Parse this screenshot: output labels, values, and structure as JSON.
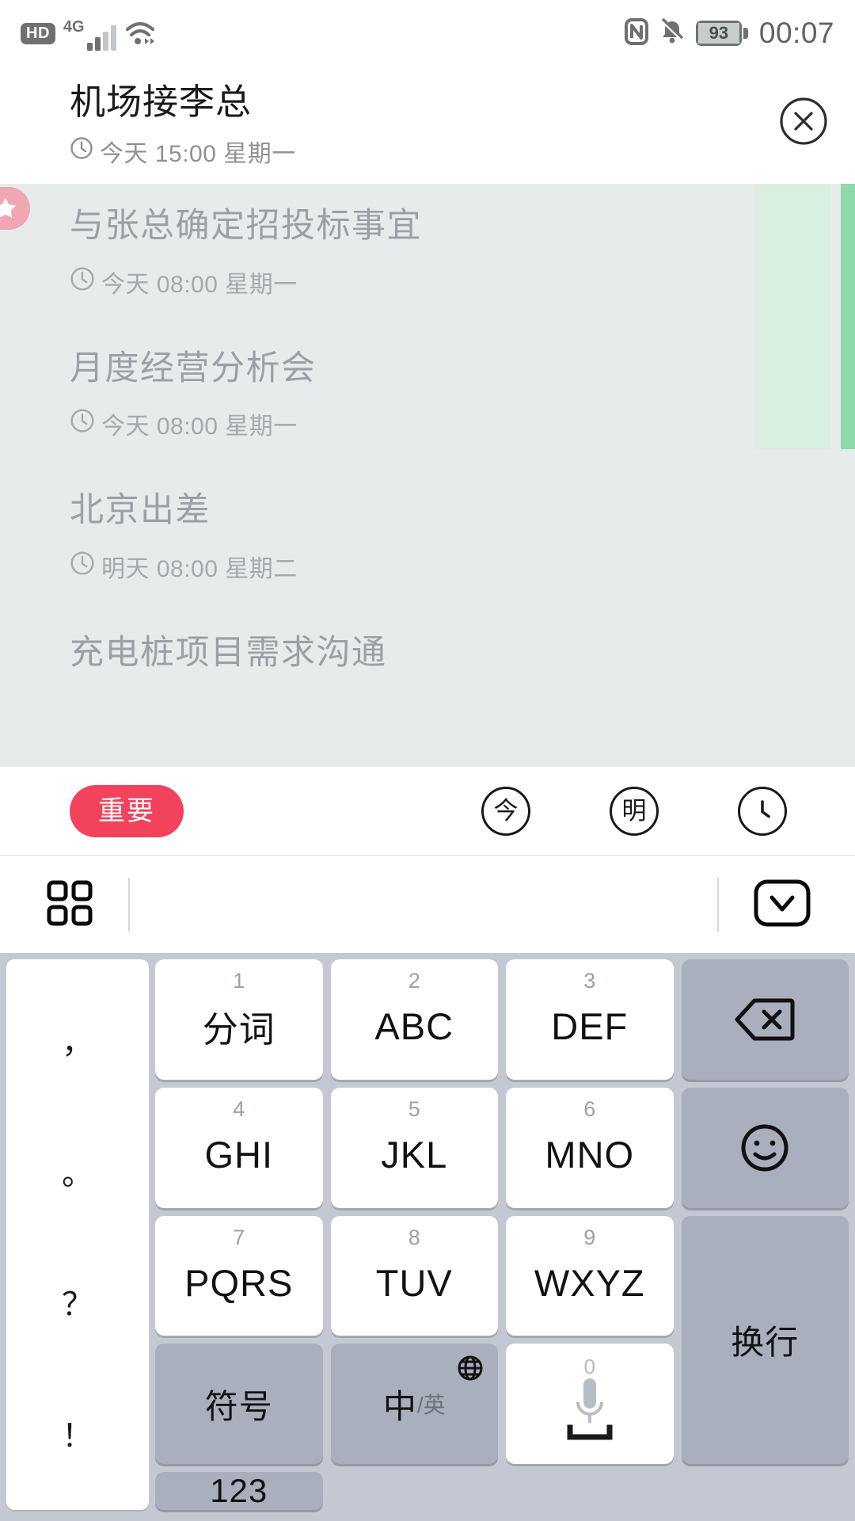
{
  "statusbar": {
    "hd_label": "HD",
    "network_label": "4G",
    "battery_level": "93",
    "time": "00:07",
    "icons": [
      "hd-badge",
      "signal-bars-icon",
      "wifi-icon",
      "nfc-icon",
      "bell-muted-icon",
      "battery-icon"
    ]
  },
  "header": {
    "title": "机场接李总",
    "datetime": "今天 15:00 星期一",
    "close_icon": "close-circle-icon"
  },
  "tasks": [
    {
      "title": "与张总确定招投标事宜",
      "datetime": "今天 08:00 星期一",
      "important": true
    },
    {
      "title": "月度经营分析会",
      "datetime": "今天 08:00 星期一",
      "important": false
    },
    {
      "title": "北京出差",
      "datetime": "明天 08:00 星期二",
      "important": false
    },
    {
      "title": "充电桩项目需求沟通",
      "datetime": "",
      "important": false
    }
  ],
  "actionbar": {
    "important_label": "重要",
    "today_label": "今",
    "tomorrow_label": "明",
    "clock_icon": "clock-icon"
  },
  "keyboard_toolbar": {
    "grid_icon": "grid-icon",
    "collapse_icon": "chevron-down-icon"
  },
  "keyboard": {
    "punctuation": [
      "，",
      "。",
      "？",
      "！"
    ],
    "keys": [
      {
        "num": "1",
        "label": "分词",
        "type": "cn"
      },
      {
        "num": "2",
        "label": "ABC",
        "type": "latin"
      },
      {
        "num": "3",
        "label": "DEF",
        "type": "latin"
      },
      {
        "num": "",
        "label": "",
        "type": "backspace",
        "icon": "backspace-icon"
      },
      {
        "num": "4",
        "label": "GHI",
        "type": "latin"
      },
      {
        "num": "5",
        "label": "JKL",
        "type": "latin"
      },
      {
        "num": "6",
        "label": "MNO",
        "type": "latin"
      },
      {
        "num": "",
        "label": "",
        "type": "emoji",
        "icon": "smiley-icon"
      },
      {
        "num": "7",
        "label": "PQRS",
        "type": "latin"
      },
      {
        "num": "8",
        "label": "TUV",
        "type": "latin"
      },
      {
        "num": "9",
        "label": "WXYZ",
        "type": "latin"
      },
      {
        "num": "",
        "label": "换行",
        "type": "enter"
      },
      {
        "num": "",
        "label": "符号",
        "type": "symbol"
      },
      {
        "num": "",
        "label": "中",
        "sub": "/英",
        "type": "lang",
        "icon": "globe-icon"
      },
      {
        "num": "0",
        "label": "",
        "type": "space",
        "icon": "microphone-icon"
      },
      {
        "num": "",
        "label": "123",
        "type": "numeric"
      }
    ]
  },
  "colors": {
    "accent_red": "#f2425c",
    "star_pink": "#f0a6b4",
    "list_bg": "#e7ebeb",
    "green_highlight": "#8fd9ab",
    "keyboard_bg": "#c3c8d2"
  }
}
